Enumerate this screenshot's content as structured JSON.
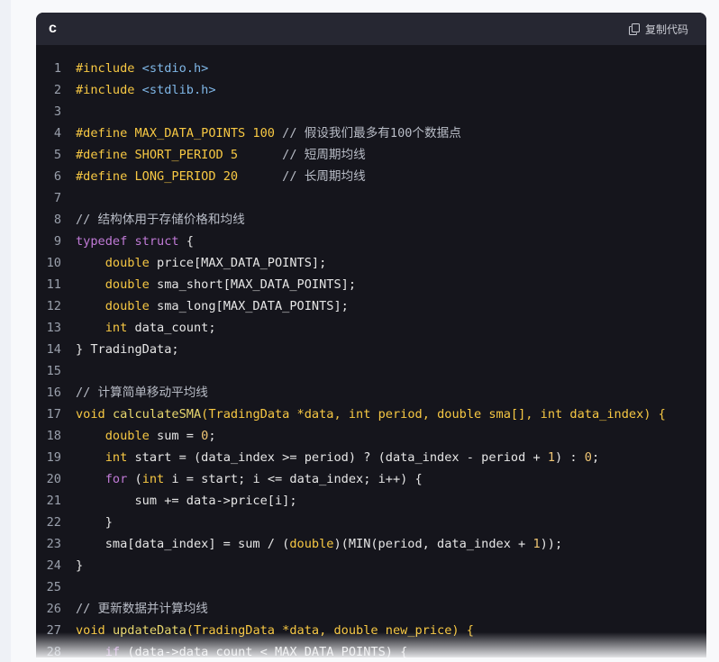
{
  "code_block": {
    "language": "c",
    "copy_label": "复制代码",
    "icon": "copy-icon",
    "lines": [
      {
        "n": "1",
        "tokens": [
          {
            "t": "#include ",
            "c": "pp"
          },
          {
            "t": "<stdio.h>",
            "c": "inc"
          }
        ]
      },
      {
        "n": "2",
        "tokens": [
          {
            "t": "#include ",
            "c": "pp"
          },
          {
            "t": "<stdlib.h>",
            "c": "inc"
          }
        ]
      },
      {
        "n": "3",
        "tokens": []
      },
      {
        "n": "4",
        "tokens": [
          {
            "t": "#define ",
            "c": "pp"
          },
          {
            "t": "MAX_DATA_POINTS 100 ",
            "c": "mac"
          },
          {
            "t": "// 假设我们最多有100个数据点",
            "c": "cm"
          }
        ]
      },
      {
        "n": "5",
        "tokens": [
          {
            "t": "#define ",
            "c": "pp"
          },
          {
            "t": "SHORT_PERIOD 5      ",
            "c": "mac"
          },
          {
            "t": "// 短周期均线",
            "c": "cm"
          }
        ]
      },
      {
        "n": "6",
        "tokens": [
          {
            "t": "#define ",
            "c": "pp"
          },
          {
            "t": "LONG_PERIOD 20      ",
            "c": "mac"
          },
          {
            "t": "// 长周期均线",
            "c": "cm"
          }
        ]
      },
      {
        "n": "7",
        "tokens": []
      },
      {
        "n": "8",
        "tokens": [
          {
            "t": "// 结构体用于存储价格和均线",
            "c": "cm"
          }
        ]
      },
      {
        "n": "9",
        "tokens": [
          {
            "t": "typedef",
            "c": "kw"
          },
          {
            "t": " ",
            "c": ""
          },
          {
            "t": "struct",
            "c": "kw"
          },
          {
            "t": " {",
            "c": ""
          }
        ]
      },
      {
        "n": "10",
        "tokens": [
          {
            "t": "    ",
            "c": ""
          },
          {
            "t": "double",
            "c": "ty"
          },
          {
            "t": " price[MAX_DATA_POINTS];",
            "c": ""
          }
        ]
      },
      {
        "n": "11",
        "tokens": [
          {
            "t": "    ",
            "c": ""
          },
          {
            "t": "double",
            "c": "ty"
          },
          {
            "t": " sma_short[MAX_DATA_POINTS];",
            "c": ""
          }
        ]
      },
      {
        "n": "12",
        "tokens": [
          {
            "t": "    ",
            "c": ""
          },
          {
            "t": "double",
            "c": "ty"
          },
          {
            "t": " sma_long[MAX_DATA_POINTS];",
            "c": ""
          }
        ]
      },
      {
        "n": "13",
        "tokens": [
          {
            "t": "    ",
            "c": ""
          },
          {
            "t": "int",
            "c": "ty"
          },
          {
            "t": " data_count;",
            "c": ""
          }
        ]
      },
      {
        "n": "14",
        "tokens": [
          {
            "t": "} TradingData;",
            "c": ""
          }
        ]
      },
      {
        "n": "15",
        "tokens": []
      },
      {
        "n": "16",
        "tokens": [
          {
            "t": "// 计算简单移动平均线",
            "c": "cm"
          }
        ]
      },
      {
        "n": "17",
        "tokens": [
          {
            "t": "void",
            "c": "ty"
          },
          {
            "t": " ",
            "c": ""
          },
          {
            "t": "calculateSMA",
            "c": "fn"
          },
          {
            "t": "(TradingData *data, ",
            "c": "ty"
          },
          {
            "t": "int",
            "c": "ty"
          },
          {
            "t": " period, ",
            "c": "ty"
          },
          {
            "t": "double",
            "c": "ty"
          },
          {
            "t": " sma[], ",
            "c": "ty"
          },
          {
            "t": "int",
            "c": "ty"
          },
          {
            "t": " data_index) {",
            "c": "ty"
          }
        ]
      },
      {
        "n": "18",
        "tokens": [
          {
            "t": "    ",
            "c": ""
          },
          {
            "t": "double",
            "c": "ty"
          },
          {
            "t": " sum = ",
            "c": ""
          },
          {
            "t": "0",
            "c": "num"
          },
          {
            "t": ";",
            "c": ""
          }
        ]
      },
      {
        "n": "19",
        "tokens": [
          {
            "t": "    ",
            "c": ""
          },
          {
            "t": "int",
            "c": "ty"
          },
          {
            "t": " start = (data_index >= period) ? (data_index - period + ",
            "c": ""
          },
          {
            "t": "1",
            "c": "num"
          },
          {
            "t": ") : ",
            "c": ""
          },
          {
            "t": "0",
            "c": "num"
          },
          {
            "t": ";",
            "c": ""
          }
        ]
      },
      {
        "n": "20",
        "tokens": [
          {
            "t": "    ",
            "c": ""
          },
          {
            "t": "for",
            "c": "kw"
          },
          {
            "t": " (",
            "c": ""
          },
          {
            "t": "int",
            "c": "ty"
          },
          {
            "t": " i = start; i <= data_index; i++) {",
            "c": ""
          }
        ]
      },
      {
        "n": "21",
        "tokens": [
          {
            "t": "        sum += data->price[i];",
            "c": ""
          }
        ]
      },
      {
        "n": "22",
        "tokens": [
          {
            "t": "    }",
            "c": ""
          }
        ]
      },
      {
        "n": "23",
        "tokens": [
          {
            "t": "    sma[data_index] = sum / (",
            "c": ""
          },
          {
            "t": "double",
            "c": "ty"
          },
          {
            "t": ")(MIN(period, data_index + ",
            "c": ""
          },
          {
            "t": "1",
            "c": "num"
          },
          {
            "t": "));",
            "c": ""
          }
        ]
      },
      {
        "n": "24",
        "tokens": [
          {
            "t": "}",
            "c": ""
          }
        ]
      },
      {
        "n": "25",
        "tokens": []
      },
      {
        "n": "26",
        "tokens": [
          {
            "t": "// 更新数据并计算均线",
            "c": "cm"
          }
        ]
      },
      {
        "n": "27",
        "tokens": [
          {
            "t": "void",
            "c": "ty"
          },
          {
            "t": " ",
            "c": ""
          },
          {
            "t": "updateData",
            "c": "fn"
          },
          {
            "t": "(TradingData *data, ",
            "c": "ty"
          },
          {
            "t": "double",
            "c": "ty"
          },
          {
            "t": " new_price) {",
            "c": "ty"
          }
        ]
      },
      {
        "n": "28",
        "tokens": [
          {
            "t": "    ",
            "c": ""
          },
          {
            "t": "if",
            "c": "kw"
          },
          {
            "t": " (data->data_count < MAX_DATA_POINTS) {",
            "c": ""
          }
        ]
      }
    ]
  }
}
